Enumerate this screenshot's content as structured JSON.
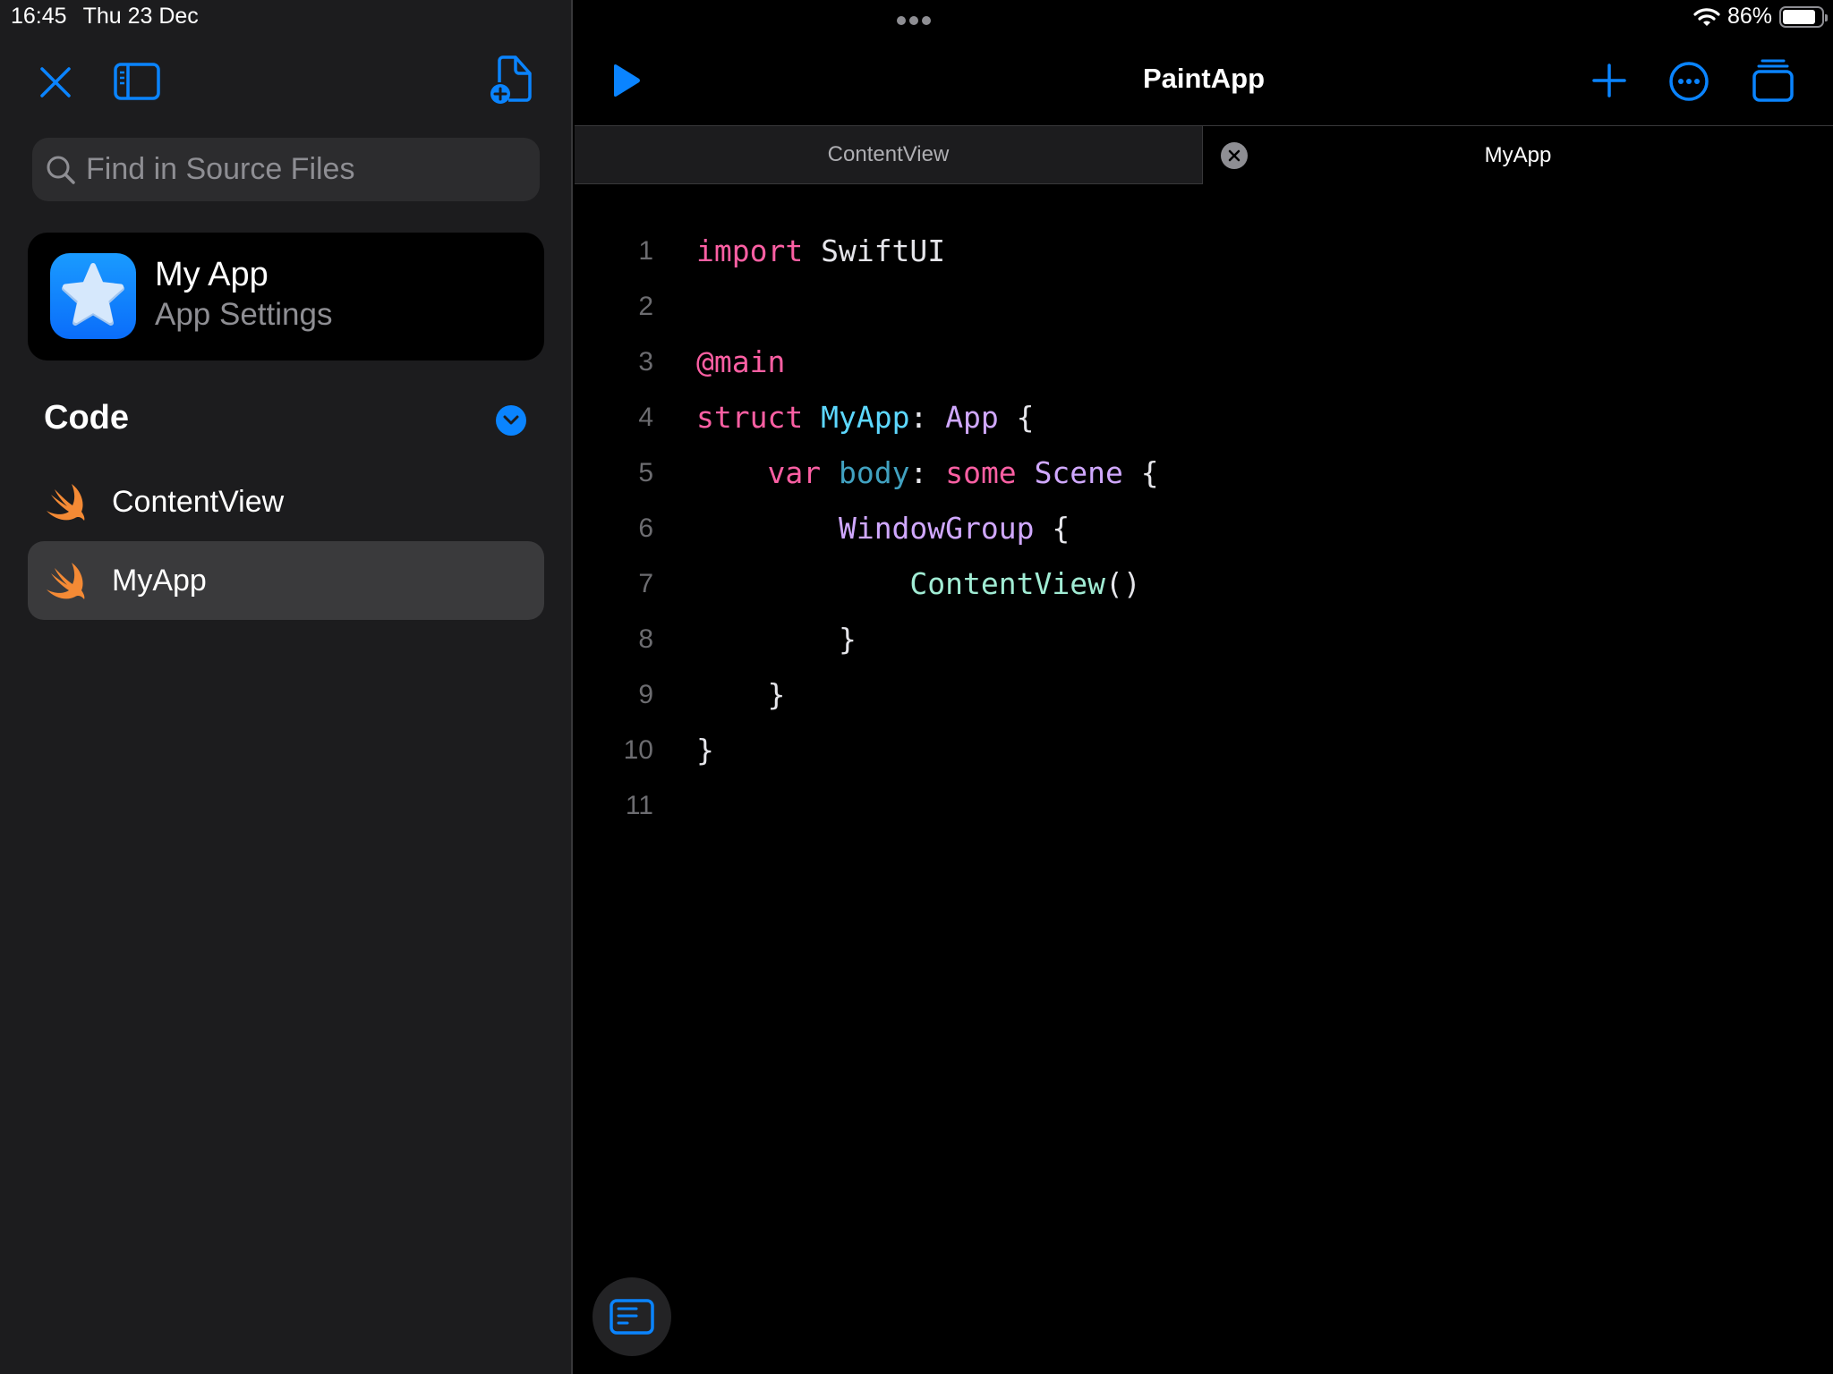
{
  "status_bar": {
    "time": "16:45",
    "date": "Thu 23 Dec",
    "battery_percent_label": "86%",
    "battery_level": 0.86,
    "wifi_icon": "wifi-icon"
  },
  "sidebar": {
    "toolbar": {
      "close_icon": "close-icon",
      "toggle_sidebar_icon": "sidebar-toggle-icon",
      "new_file_icon": "new-file-icon"
    },
    "search": {
      "placeholder": "Find in Source Files",
      "value": ""
    },
    "app_card": {
      "name": "My App",
      "subtitle": "App Settings",
      "icon": "star-app-icon"
    },
    "section": {
      "title": "Code",
      "expanded": true
    },
    "files": [
      {
        "name": "ContentView",
        "icon": "swift-icon",
        "selected": false
      },
      {
        "name": "MyApp",
        "icon": "swift-icon",
        "selected": true
      }
    ]
  },
  "editor": {
    "title": "PaintApp",
    "toolbar": {
      "run_icon": "play-icon",
      "add_icon": "plus-icon",
      "more_icon": "ellipsis-circle-icon",
      "windows_icon": "stacked-windows-icon"
    },
    "tabs": [
      {
        "label": "ContentView",
        "active": false
      },
      {
        "label": "MyApp",
        "active": true
      }
    ],
    "code_lines": [
      {
        "number": "1",
        "tokens": [
          [
            "kw",
            "import"
          ],
          [
            "plain",
            " SwiftUI"
          ]
        ]
      },
      {
        "number": "2",
        "tokens": []
      },
      {
        "number": "3",
        "tokens": [
          [
            "kw",
            "@main"
          ]
        ]
      },
      {
        "number": "4",
        "tokens": [
          [
            "kw",
            "struct"
          ],
          [
            "plain",
            " "
          ],
          [
            "type",
            "MyApp"
          ],
          [
            "plain",
            ": "
          ],
          [
            "ptype",
            "App"
          ],
          [
            "plain",
            " {"
          ]
        ]
      },
      {
        "number": "5",
        "tokens": [
          [
            "plain",
            "    "
          ],
          [
            "kw",
            "var"
          ],
          [
            "plain",
            " "
          ],
          [
            "prop",
            "body"
          ],
          [
            "plain",
            ": "
          ],
          [
            "kw",
            "some"
          ],
          [
            "plain",
            " "
          ],
          [
            "ptype",
            "Scene"
          ],
          [
            "plain",
            " {"
          ]
        ]
      },
      {
        "number": "6",
        "tokens": [
          [
            "plain",
            "        "
          ],
          [
            "ptype",
            "WindowGroup"
          ],
          [
            "plain",
            " {"
          ]
        ]
      },
      {
        "number": "7",
        "tokens": [
          [
            "plain",
            "            "
          ],
          [
            "call",
            "ContentView"
          ],
          [
            "plain",
            "()"
          ]
        ]
      },
      {
        "number": "8",
        "tokens": [
          [
            "plain",
            "        }"
          ]
        ]
      },
      {
        "number": "9",
        "tokens": [
          [
            "plain",
            "    }"
          ]
        ]
      },
      {
        "number": "10",
        "tokens": [
          [
            "plain",
            "}"
          ]
        ]
      },
      {
        "number": "11",
        "tokens": []
      }
    ],
    "console_button_icon": "console-icon"
  },
  "colors": {
    "accent": "#0a84ff",
    "sidebar_bg": "#1c1c1e",
    "editor_bg": "#000000",
    "keyword": "#fc5fa3",
    "type_decl": "#5dd8ff",
    "other_type": "#d0a8ff",
    "property": "#41a1c0",
    "call": "#a1ecd4",
    "swift_orange": "#f48a35"
  }
}
